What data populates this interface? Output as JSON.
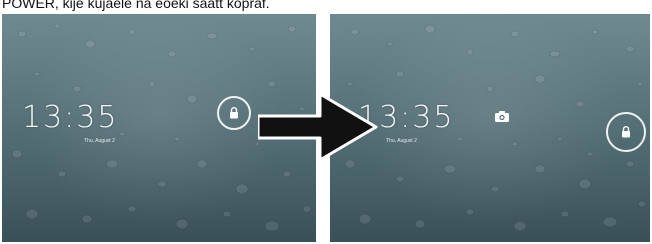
{
  "caption": "POWER, kije kujaele na eoeki saatt kopraf.",
  "left_screen": {
    "time": "13:35",
    "date": "Thu, August 2",
    "icons": [
      "lock-icon"
    ]
  },
  "right_screen": {
    "time": "13:35",
    "date": "Thu, August 2",
    "icons": [
      "camera-icon",
      "lock-icon"
    ]
  },
  "colors": {
    "wallpaper_top": "#6f8b91",
    "wallpaper_bottom": "#3a5058",
    "arrow": "#111111",
    "ring": "#ffffff"
  }
}
